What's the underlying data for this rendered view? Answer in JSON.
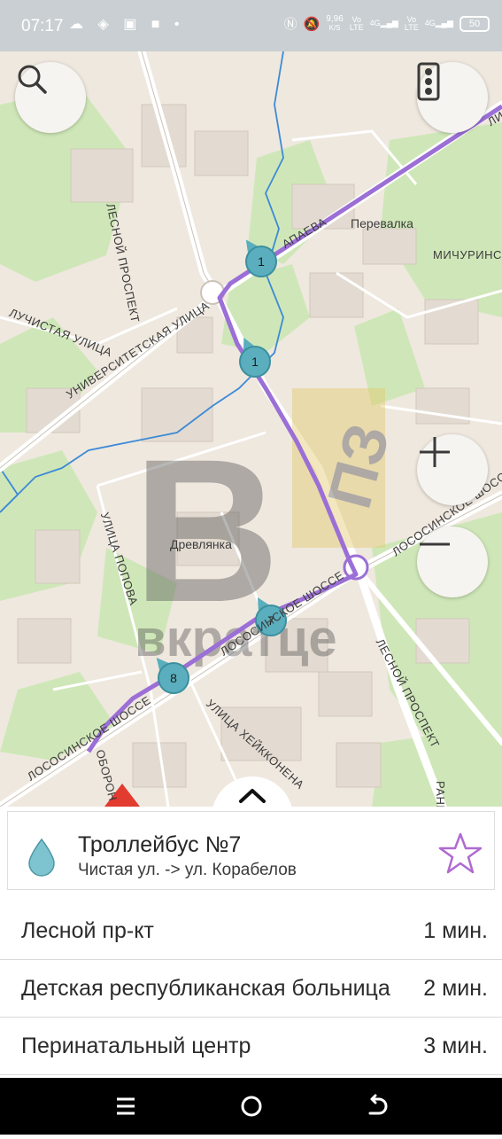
{
  "status_bar": {
    "time": "07:17",
    "left_icons": "☁ ◈ ▣ ■ •",
    "net_speed_value": "9,96",
    "net_speed_unit": "K/S",
    "net1_top": "Vo",
    "net1_bottom": "LTE",
    "net2_top": "4G",
    "net3_top": "Vo",
    "net3_bottom": "LTE",
    "net4_top": "4G",
    "battery": "50"
  },
  "map": {
    "labels": {
      "perevalka": "Перевалка",
      "michurinskaya": "МИЧУРИНСК",
      "lesnoy_prospekt_top": "ЛЕСНОЙ ПРОСПЕКТ",
      "papaeva": "АПАЕВА",
      "luchistaya": "ЛУЧИСТАЯ УЛИЦА",
      "universitetskaya": "УНИВЕРСИТЕТСКАЯ УЛИЦА",
      "drevlyanka": "Древлянка",
      "popova": "УЛИЦА ПОПОВА",
      "lososinskoe_right": "ЛОСОСИНСКОЕ ШОССЕ",
      "lososinskoe_mid": "ЛОСОСИНСКОЕ ШОССЕ",
      "lososinskoe_left": "ЛОСОСИНСКОЕ ШОССЕ",
      "lesnoy_prospekt_bottom": "ЛЕСНОЙ ПРОСПЕКТ",
      "heikkonena": "УЛИЦА ХЕЙККОНЕНА",
      "oboron": "ОБОРОН",
      "rany": "РАНЫ",
      "uli": "ЛИ"
    },
    "watermark": {
      "letter": "В",
      "text": "вкратце",
      "pz": "ПЗ"
    },
    "markers": [
      {
        "label": "1"
      },
      {
        "label": "1"
      },
      {
        "label": "7"
      },
      {
        "label": "8"
      }
    ],
    "colors": {
      "route": "#9b6fd6",
      "marker": "#5aaebd",
      "water": "#3d8ad6",
      "park": "#c8e6b0",
      "background": "#efe8df"
    },
    "icons": {
      "search": "search-icon",
      "traffic": "traffic-light-icon",
      "zoom_in": "plus-icon",
      "zoom_out": "minus-icon",
      "expand": "chevron-up-icon"
    }
  },
  "route_card": {
    "title": "Троллейбус №7",
    "subtitle": "Чистая ул. -> ул. Корабелов",
    "icons": {
      "drop": "drop-icon",
      "favorite": "star-icon"
    }
  },
  "stops": [
    {
      "name": "Лесной пр-кт",
      "time": "1 мин."
    },
    {
      "name": "Детская республиканская больница",
      "time": "2 мин."
    },
    {
      "name": "Перинатальный центр",
      "time": "3 мин."
    }
  ],
  "nav_bar": {
    "icons": [
      "menu-icon",
      "home-icon",
      "back-icon"
    ]
  }
}
